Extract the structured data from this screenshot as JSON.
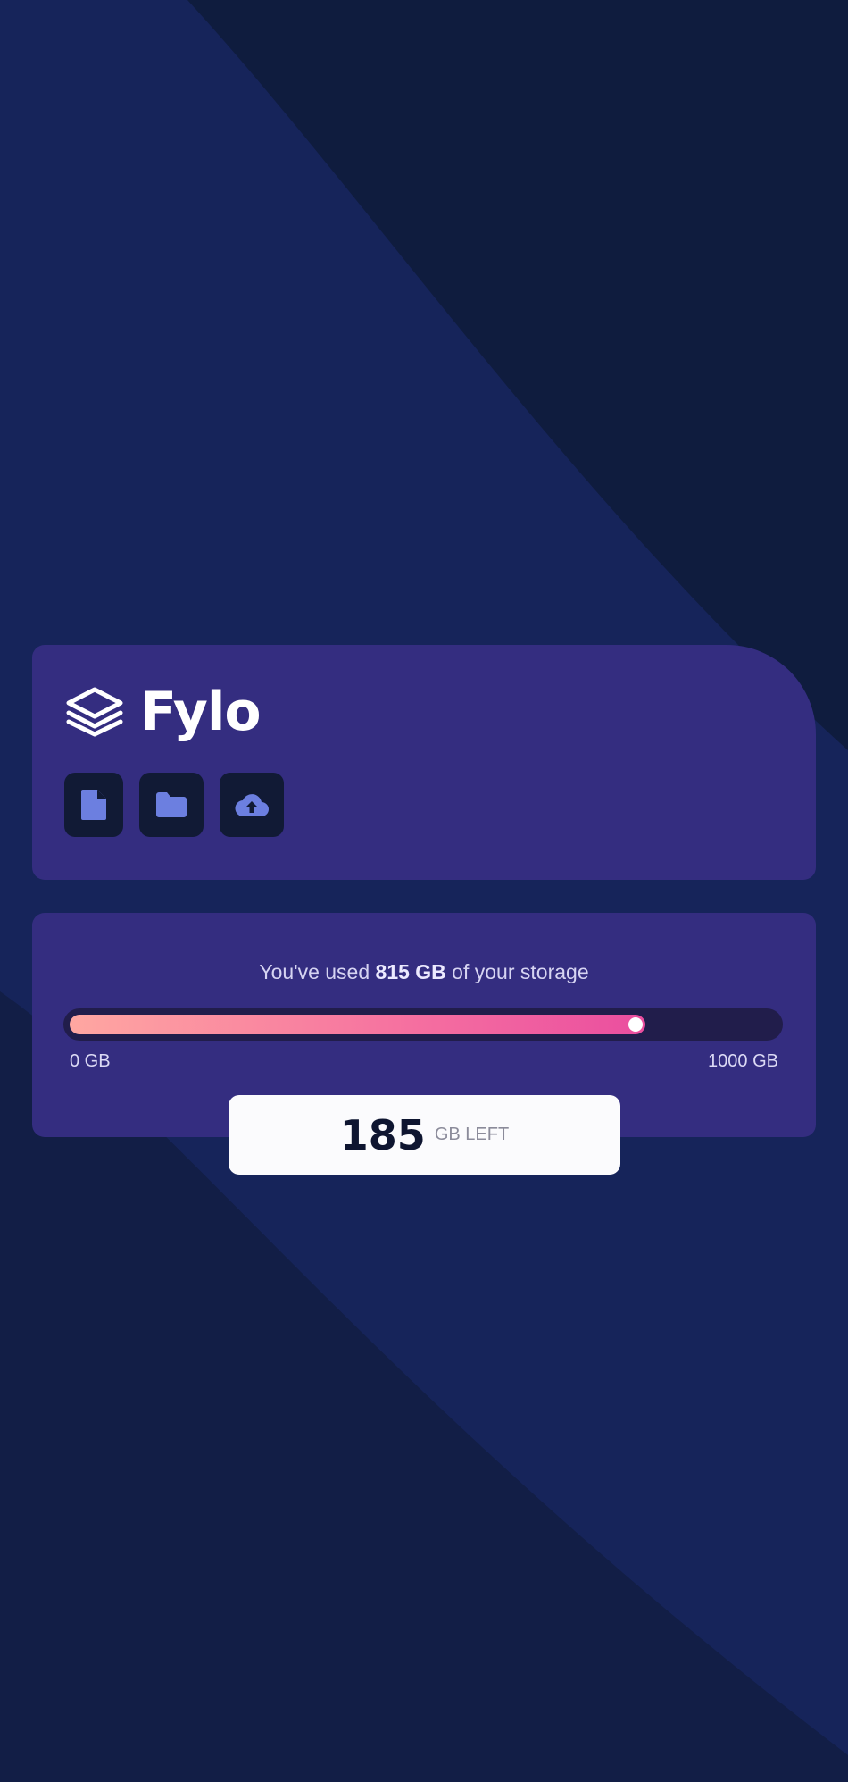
{
  "app": {
    "brand": "Fylo"
  },
  "toolbar": {
    "icons": [
      "document-icon",
      "folder-icon",
      "cloud-upload-icon"
    ]
  },
  "storage": {
    "used_prefix": "You've used ",
    "used_amount": "815 GB",
    "used_suffix": " of your storage",
    "used_fraction": 0.815,
    "scale_min": "0 GB",
    "scale_max": "1000 GB",
    "remaining_value": "185",
    "remaining_unit": "GB LEFT"
  },
  "colors": {
    "background": "#0f1b3d",
    "card": "#342d80",
    "icon_tile": "#111a35",
    "icon_accent": "#6c7fe0",
    "bar_gradient_start": "#ffa7a1",
    "bar_gradient_end": "#ea4e9f"
  }
}
